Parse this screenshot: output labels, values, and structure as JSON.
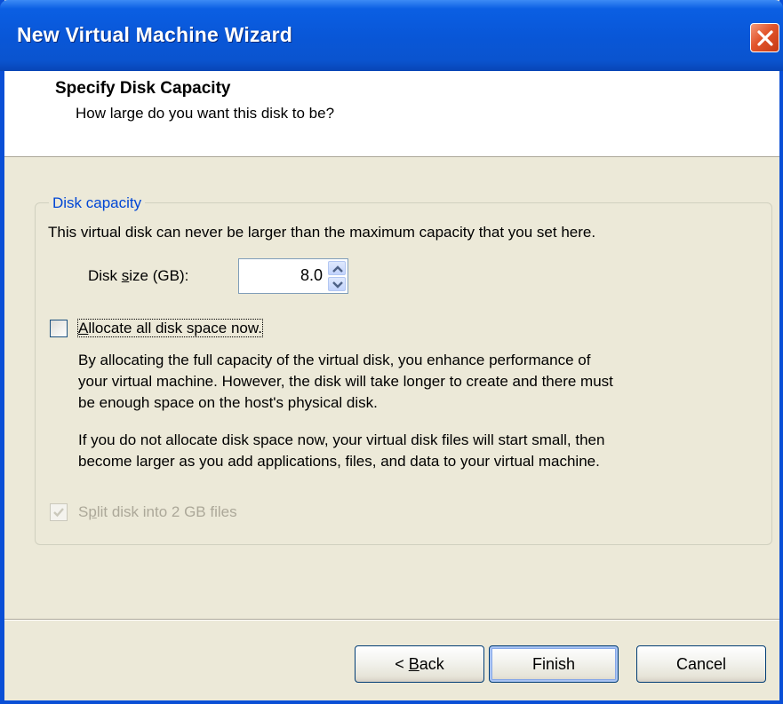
{
  "window": {
    "title": "New Virtual Machine Wizard"
  },
  "header": {
    "title": "Specify Disk Capacity",
    "subtitle": "How large do you want this disk to be?"
  },
  "group": {
    "legend": "Disk capacity",
    "description": "This virtual disk can never be larger than the maximum capacity that you set here."
  },
  "disk_size": {
    "label_prefix": "Disk ",
    "label_mnemonic": "s",
    "label_suffix": "ize (GB):",
    "value": "8.0"
  },
  "allocate": {
    "label_mnemonic": "A",
    "label_rest": "llocate all disk space now.",
    "checked": false,
    "description_lines": [
      "By allocating the full capacity of the virtual disk, you enhance performance of",
      "your virtual machine.  However, the disk will take longer to create and there must",
      "be enough space on the host's physical disk."
    ],
    "note_lines": [
      "If you do not allocate disk space now, your virtual disk files will start small, then",
      "become larger as you add applications, files, and data to your virtual machine."
    ]
  },
  "split": {
    "label_prefix": "S",
    "label_mnemonic": "p",
    "label_suffix": "lit disk into 2 GB files",
    "checked": true,
    "enabled": false
  },
  "buttons": {
    "back_prefix": "< ",
    "back_mnemonic": "B",
    "back_suffix": "ack",
    "finish": "Finish",
    "cancel": "Cancel"
  },
  "colors": {
    "titlebar": "#0957d8",
    "dialog_bg": "#ece9d8",
    "legend_text": "#0046d5",
    "disabled_text": "#aca899"
  },
  "icons": {
    "close": "close-x-icon",
    "spin_up": "spin-up-arrow-icon",
    "spin_down": "spin-down-arrow-icon",
    "checkmark": "checkmark-icon"
  }
}
